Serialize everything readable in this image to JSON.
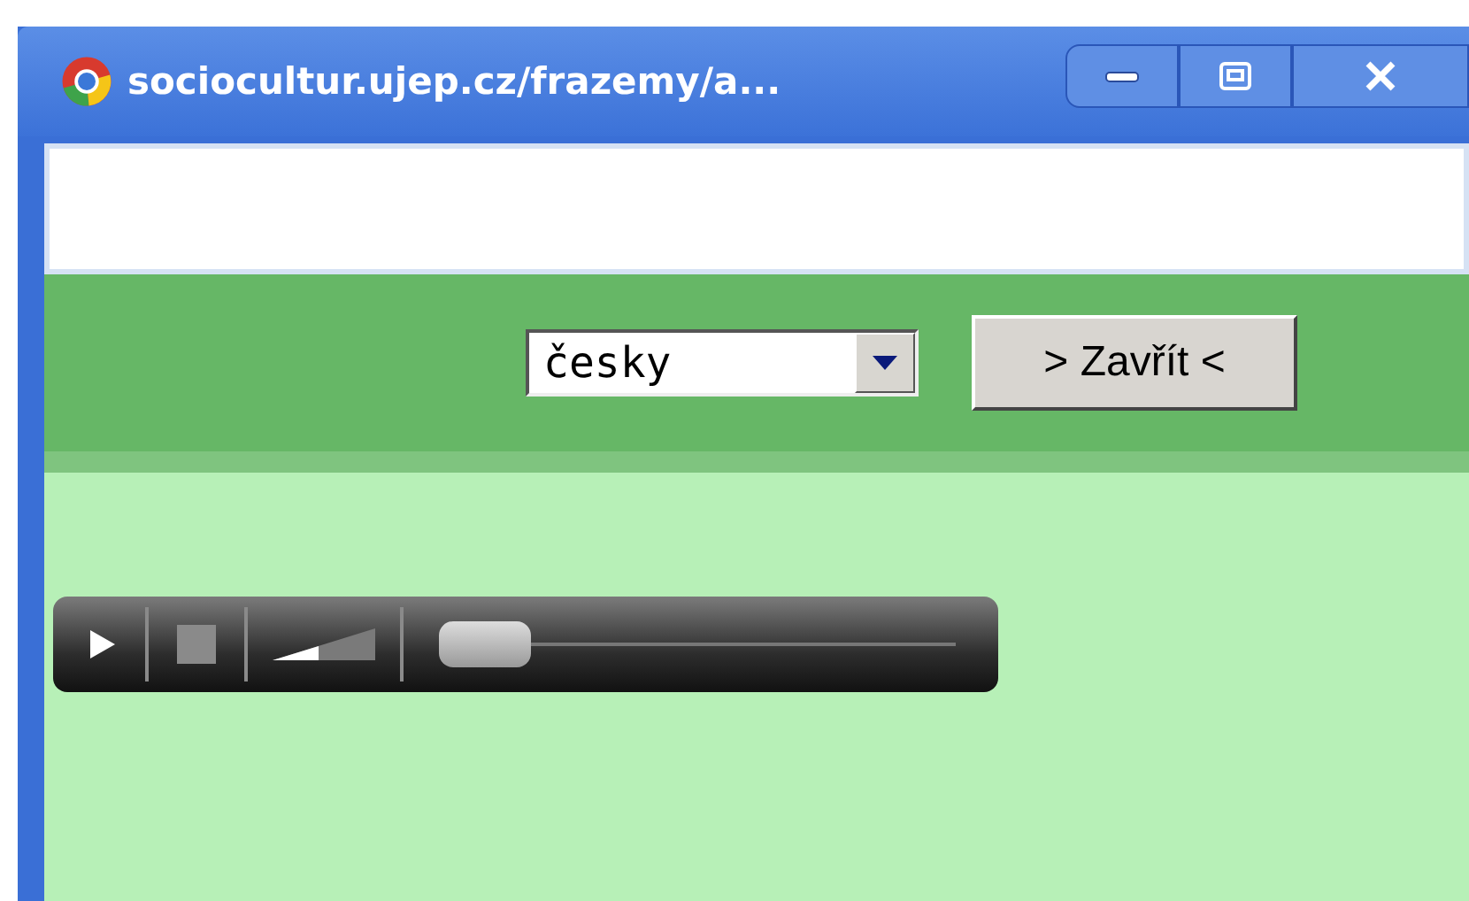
{
  "window": {
    "title": "sociocultur.ujep.cz/frazemy/a..."
  },
  "language_select": {
    "value": "česky"
  },
  "close_button": {
    "label": "> Zavřít <"
  }
}
